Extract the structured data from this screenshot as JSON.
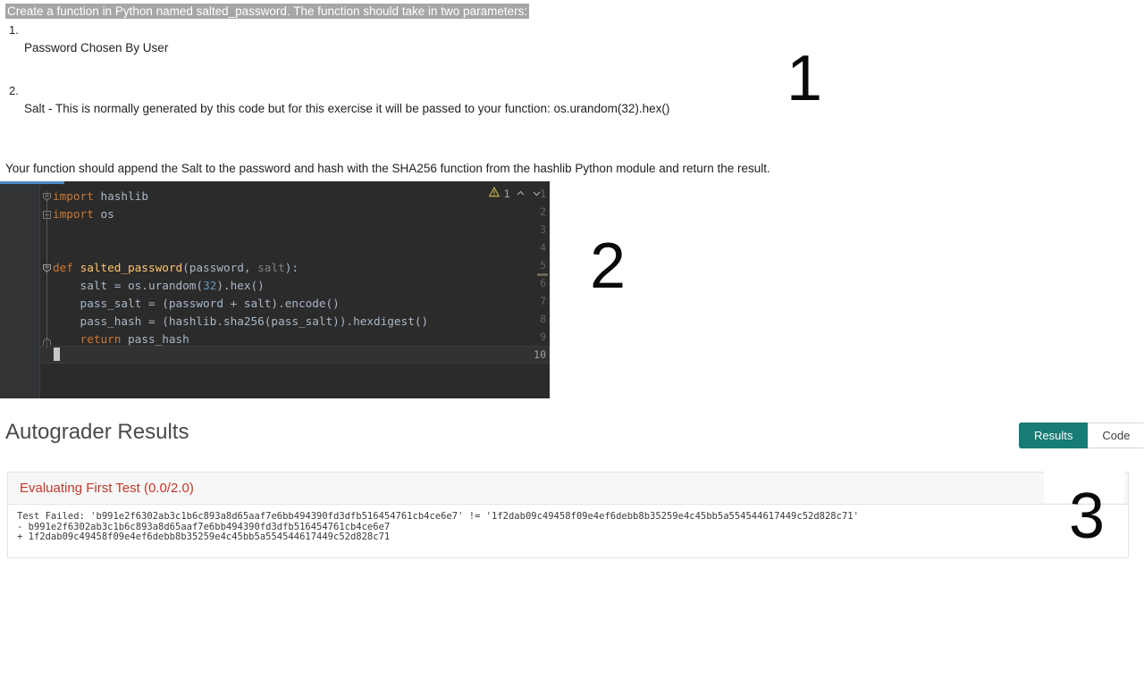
{
  "instructions": {
    "prompt": "Create a function in Python named salted_password.  The function should take in two parameters:",
    "items": [
      {
        "number": "1.",
        "text": "Password Chosen By User"
      },
      {
        "number": "2.",
        "text": "Salt - This is normally generated by this code but for this exercise it will be passed to your function: os.urandom(32).hex()"
      }
    ],
    "paragraph": "Your function should append the Salt to the password and hash with the SHA256 function from the hashlib Python module and return the result."
  },
  "annotations": [
    {
      "label": "1"
    },
    {
      "label": "2"
    },
    {
      "label": "3"
    }
  ],
  "editor": {
    "line_numbers": [
      "1",
      "2",
      "3",
      "4",
      "5",
      "6",
      "7",
      "8",
      "9",
      "10"
    ],
    "inspection": {
      "warning_count": "1",
      "warning_icon": "warning-triangle-icon",
      "prev_icon": "chevron-up-icon",
      "next_icon": "chevron-down-icon"
    },
    "lines": [
      {
        "n": 1,
        "tokens": [
          {
            "t": "import",
            "c": "kw"
          },
          {
            "t": " hashlib",
            "c": "pln"
          }
        ]
      },
      {
        "n": 2,
        "tokens": [
          {
            "t": "import",
            "c": "kw"
          },
          {
            "t": " os",
            "c": "pln"
          }
        ]
      },
      {
        "n": 3,
        "tokens": []
      },
      {
        "n": 4,
        "tokens": []
      },
      {
        "n": 5,
        "tokens": [
          {
            "t": "def ",
            "c": "kw"
          },
          {
            "t": "salted_password",
            "c": "fn"
          },
          {
            "t": "(password, ",
            "c": "pln"
          },
          {
            "t": "salt",
            "c": "dim"
          },
          {
            "t": "):",
            "c": "pln"
          }
        ]
      },
      {
        "n": 6,
        "tokens": [
          {
            "t": "    salt = os.urandom(",
            "c": "pln"
          },
          {
            "t": "32",
            "c": "num"
          },
          {
            "t": ").hex()",
            "c": "pln"
          }
        ]
      },
      {
        "n": 7,
        "tokens": [
          {
            "t": "    pass_salt = (password + salt).encode()",
            "c": "pln"
          }
        ]
      },
      {
        "n": 8,
        "tokens": [
          {
            "t": "    pass_hash = (hashlib.sha256(pass_salt)).hexdigest()",
            "c": "pln"
          }
        ]
      },
      {
        "n": 9,
        "tokens": [
          {
            "t": "    ",
            "c": "pln"
          },
          {
            "t": "return",
            "c": "kw"
          },
          {
            "t": " pass_hash",
            "c": "pln"
          }
        ]
      },
      {
        "n": 10,
        "tokens": []
      }
    ],
    "colors": {
      "background": "#2b2b2b",
      "gutter": "#313335",
      "keyword": "#cc7832",
      "function": "#ffc66d",
      "number": "#6897bb",
      "plain": "#a9b7c6",
      "unused": "#808080",
      "tab_accent": "#4a88c7"
    }
  },
  "autograder": {
    "title": "Autograder Results",
    "toggle": {
      "results_label": "Results",
      "code_label": "Code",
      "active": "Results",
      "active_color": "#167c74"
    },
    "result": {
      "header": "Evaluating First Test (0.0/2.0)",
      "header_color": "#c0392b",
      "output_lines": [
        "Test Failed: 'b991e2f6302ab3c1b6c893a8d65aaf7e6bb494390fd3dfb516454761cb4ce6e7' != '1f2dab09c49458f09e4ef6debb8b35259e4c45bb5a554544617449c52d828c71'",
        "- b991e2f6302ab3c1b6c893a8d65aaf7e6bb494390fd3dfb516454761cb4ce6e7",
        "+ 1f2dab09c49458f09e4ef6debb8b35259e4c45bb5a554544617449c52d828c71"
      ]
    }
  }
}
